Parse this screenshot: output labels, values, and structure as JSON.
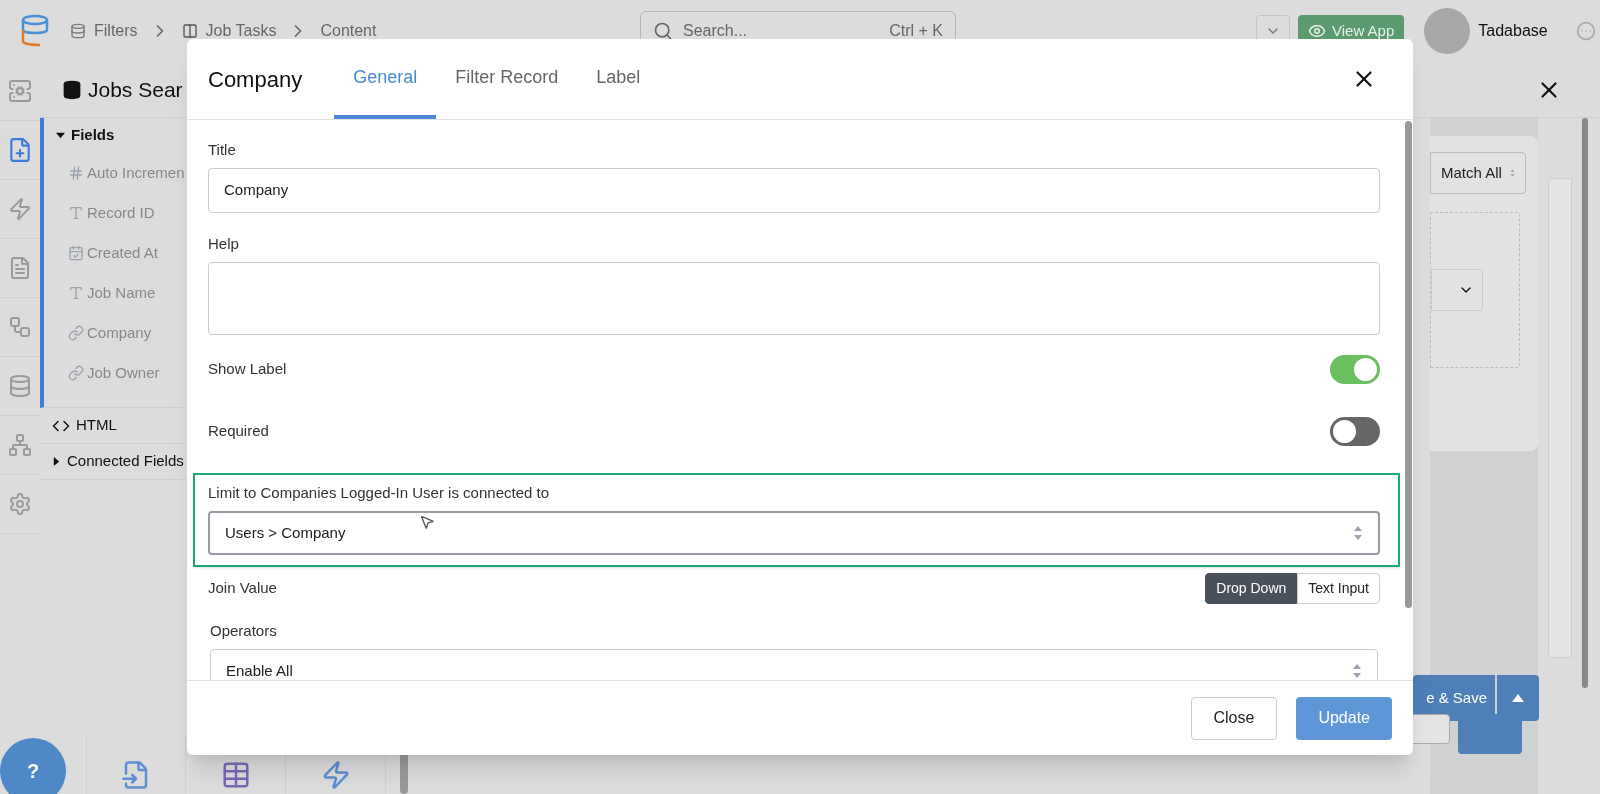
{
  "top_bar": {
    "breadcrumbs": [
      {
        "kind": "database",
        "label": "Filters"
      },
      {
        "kind": "table",
        "label": "Job Tasks"
      },
      {
        "kind": "plain",
        "label": "Content"
      }
    ],
    "search": {
      "placeholder": "Search...",
      "shortcut": "Ctrl + K"
    },
    "view_app": "View App",
    "user": "Tadabase"
  },
  "panel": {
    "title": "Jobs Sear",
    "sections": [
      {
        "kind": "group",
        "label": "Fields",
        "expanded": true,
        "items": [
          {
            "kind": "number",
            "label": "Auto Incremen"
          },
          {
            "kind": "text",
            "label": "Record ID"
          },
          {
            "kind": "date",
            "label": "Created At"
          },
          {
            "kind": "text",
            "label": "Job Name"
          },
          {
            "kind": "link",
            "label": "Company"
          },
          {
            "kind": "link",
            "label": "Job Owner"
          }
        ]
      },
      {
        "kind": "code",
        "label": "HTML"
      },
      {
        "kind": "group",
        "label": "Connected Fields",
        "expanded": false
      }
    ],
    "match_select": "Match All",
    "save_button": "e & Save"
  },
  "help_button": "?",
  "modal": {
    "title": "Company",
    "tabs": [
      {
        "label": "General",
        "selected": true
      },
      {
        "label": "Filter Record",
        "selected": false
      },
      {
        "label": "Label",
        "selected": false
      }
    ],
    "fields": [
      {
        "kind": "text",
        "label": "Title",
        "value": "Company"
      },
      {
        "kind": "textarea",
        "label": "Help"
      },
      {
        "kind": "toggle",
        "label": "Show Label",
        "on": true
      },
      {
        "kind": "toggle",
        "label": "Required",
        "on": false
      },
      {
        "kind": "select",
        "label": "Limit to Companies Logged-In User is connected to",
        "value": "Users > Company",
        "highlighted": true
      },
      {
        "kind": "segmented",
        "label": "Join Value",
        "options": [
          {
            "label": "Drop Down",
            "selected": true
          },
          {
            "label": "Text Input",
            "selected": false
          }
        ]
      },
      {
        "kind": "select",
        "label": "Operators",
        "value": "Enable All",
        "highlighted": false
      }
    ],
    "buttons": [
      {
        "kind": "secondary",
        "label": "Close"
      },
      {
        "kind": "primary",
        "label": "Update"
      }
    ]
  }
}
